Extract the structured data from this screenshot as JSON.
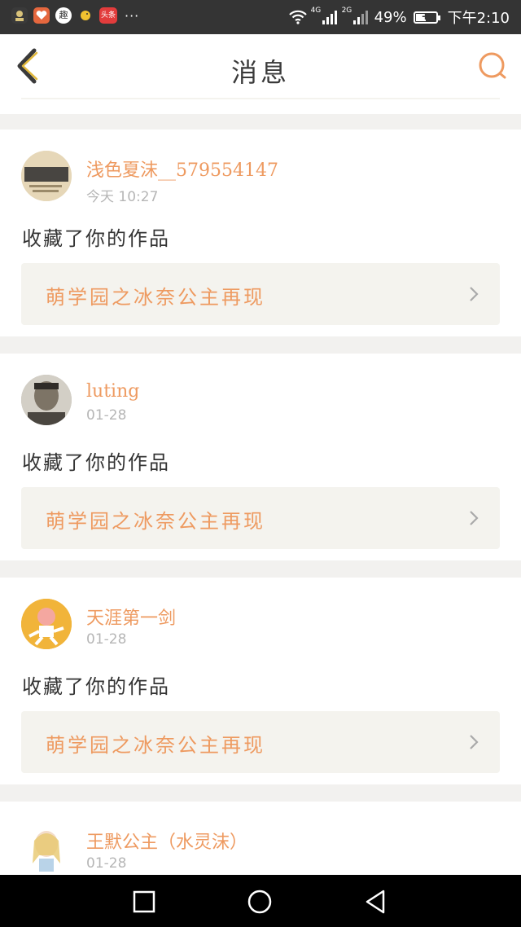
{
  "status_bar": {
    "notification_icons": [
      "reading-app-icon",
      "heart-app-icon",
      "qu-app-icon",
      "chick-app-icon",
      "toutiao-app-icon"
    ],
    "qu_label": "趣",
    "toutiao_label": "头条",
    "more": "···",
    "network_1": "4G",
    "network_2": "2G",
    "battery": "49%",
    "battery_level": 0.49,
    "time": "下午2:10"
  },
  "header": {
    "title": "消息"
  },
  "messages": [
    {
      "user": "浅色夏沫__579554147",
      "time": "今天 10:27",
      "action": "收藏了你的作品",
      "work": "萌学园之冰奈公主再现",
      "avatar": "avatar-book-cover"
    },
    {
      "user": "luting",
      "time": "01-28",
      "action": "收藏了你的作品",
      "work": "萌学园之冰奈公主再现",
      "avatar": "avatar-man-photo"
    },
    {
      "user": "天涯第一剑",
      "time": "01-28",
      "action": "收藏了你的作品",
      "work": "萌学园之冰奈公主再现",
      "avatar": "avatar-cartoon-kungfu"
    },
    {
      "user": "王默公主（水灵沫）",
      "time": "01-28",
      "avatar": "avatar-anime-girl"
    }
  ],
  "colors": {
    "accent": "#ee9a60",
    "header_bg": "#ffffff",
    "page_bg": "#f2f1ef",
    "work_bg": "#f4f3ee"
  },
  "nav": {
    "buttons": [
      "recents-square-icon",
      "home-circle-icon",
      "back-triangle-icon"
    ]
  }
}
